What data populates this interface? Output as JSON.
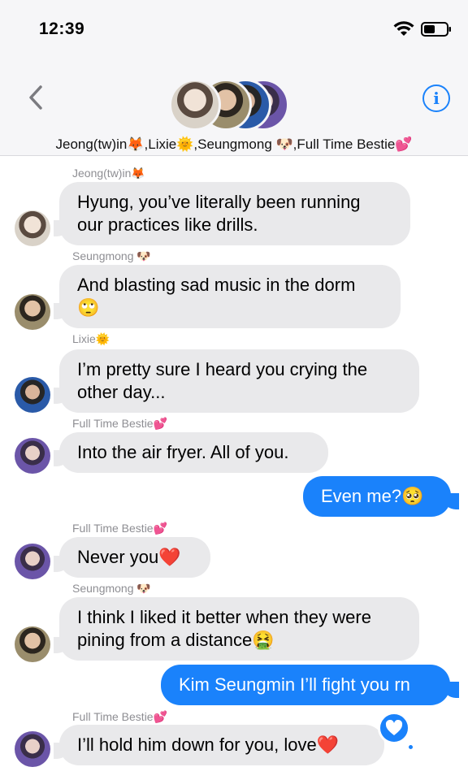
{
  "status_bar": {
    "time": "12:39"
  },
  "header": {
    "group_names": "Jeong(tw)in🦊,Lixie🌞,Seungmong 🐶,Full Time Bestie💕"
  },
  "messages": [
    {
      "sender": "Jeong(tw)in🦊",
      "lines": [
        "Hyung, you’ve literally been running",
        "our practices like drills."
      ]
    },
    {
      "sender": "Seungmong 🐶",
      "lines": [
        "And blasting sad music in the dorm",
        "🙄"
      ]
    },
    {
      "sender": "Lixie🌞",
      "lines": [
        "I’m pretty sure I heard you crying the",
        "other day..."
      ]
    },
    {
      "sender": "Full Time Bestie💕",
      "lines": [
        "Into the air fryer. All of you."
      ]
    },
    {
      "text": "Even me?🥺"
    },
    {
      "sender": "Full Time Bestie💕",
      "lines": [
        "Never you❤️"
      ]
    },
    {
      "sender": "Seungmong 🐶",
      "lines": [
        "I think I liked it better when they were",
        "pining from a distance🤮"
      ]
    },
    {
      "text": "Kim Seungmin I’ll fight you rn"
    },
    {
      "sender": "Full Time Bestie💕",
      "lines": [
        "I’ll hold him down for you, love❤️"
      ]
    }
  ],
  "colors": {
    "outgoing": "#1a82fb",
    "incoming": "#e9e9eb",
    "accent": "#1a82fb"
  },
  "icons": {
    "reaction": "heart-icon"
  }
}
